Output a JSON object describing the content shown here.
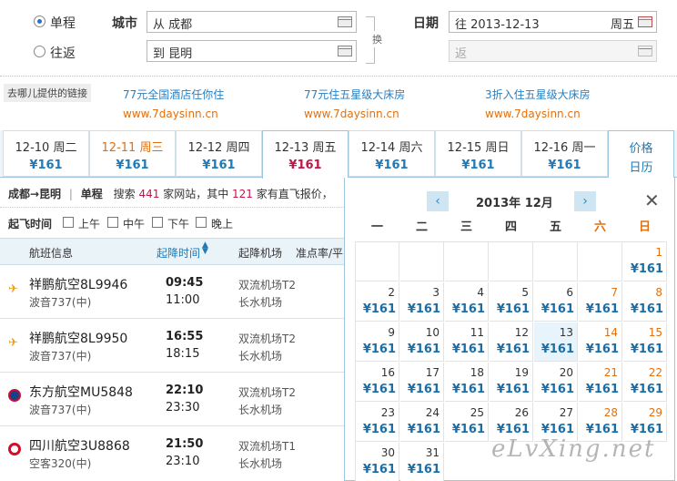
{
  "search": {
    "trip_one_way": "单程",
    "trip_round": "往返",
    "city_label": "城市",
    "from_value": "从 成都",
    "to_value": "到 昆明",
    "swap_label": "换",
    "date_label": "日期",
    "depart_value": "往 2013-12-13",
    "depart_weekday": "周五",
    "return_placeholder": "返"
  },
  "ads": {
    "provider": "去哪儿提供的链接",
    "items": [
      {
        "title": "77元全国酒店任你住",
        "url": "www.7daysinn.cn"
      },
      {
        "title": "77元住五星级大床房",
        "url": "www.7daysinn.cn"
      },
      {
        "title": "3折入住五星级大床房",
        "url": "www.7daysinn.cn"
      }
    ]
  },
  "date_tabs": [
    {
      "date": "12-10 周二",
      "price": "¥161"
    },
    {
      "date": "12-11 周三",
      "price": "¥161"
    },
    {
      "date": "12-12 周四",
      "price": "¥161"
    },
    {
      "date": "12-13 周五",
      "price": "¥161"
    },
    {
      "date": "12-14 周六",
      "price": "¥161"
    },
    {
      "date": "12-15 周日",
      "price": "¥161"
    },
    {
      "date": "12-16 周一",
      "price": "¥161"
    }
  ],
  "price_calendar_tab": {
    "line1": "价格",
    "line2": "日历"
  },
  "summary": {
    "route": "成都→昆明",
    "sep": "|",
    "trip": "单程",
    "text1": "搜索",
    "count1": "441",
    "text2": "家网站，其中",
    "count2": "121",
    "text3": "家有直飞报价，"
  },
  "filter": {
    "label": "起飞时间",
    "options": [
      "上午",
      "中午",
      "下午",
      "晚上"
    ]
  },
  "columns": {
    "flight": "航班信息",
    "time": "起降时间",
    "airport": "起降机场",
    "punctuality": "准点率/平"
  },
  "flights": [
    {
      "name": "祥鹏航空8L9946",
      "plane": "波音737(中)",
      "dep": "09:45",
      "arr": "11:00",
      "dep_airport": "双流机场T2",
      "arr_airport": "长水机场"
    },
    {
      "name": "祥鹏航空8L9950",
      "plane": "波音737(中)",
      "dep": "16:55",
      "arr": "18:15",
      "dep_airport": "双流机场T2",
      "arr_airport": "长水机场"
    },
    {
      "name": "东方航空MU5848",
      "plane": "波音737(中)",
      "dep": "22:10",
      "arr": "23:30",
      "dep_airport": "双流机场T2",
      "arr_airport": "长水机场"
    },
    {
      "name": "四川航空3U8868",
      "plane": "空客320(中)",
      "dep": "21:50",
      "arr": "23:10",
      "dep_airport": "双流机场T1",
      "arr_airport": "长水机场"
    }
  ],
  "calendar": {
    "title": "2013年 12月",
    "weekdays": [
      "一",
      "二",
      "三",
      "四",
      "五",
      "六",
      "日"
    ],
    "days": [
      {
        "d": "1",
        "p": "¥161"
      },
      {
        "d": "2",
        "p": "¥161"
      },
      {
        "d": "3",
        "p": "¥161"
      },
      {
        "d": "4",
        "p": "¥161"
      },
      {
        "d": "5",
        "p": "¥161"
      },
      {
        "d": "6",
        "p": "¥161"
      },
      {
        "d": "7",
        "p": "¥161"
      },
      {
        "d": "8",
        "p": "¥161"
      },
      {
        "d": "9",
        "p": "¥161"
      },
      {
        "d": "10",
        "p": "¥161"
      },
      {
        "d": "11",
        "p": "¥161"
      },
      {
        "d": "12",
        "p": "¥161"
      },
      {
        "d": "13",
        "p": "¥161"
      },
      {
        "d": "14",
        "p": "¥161"
      },
      {
        "d": "15",
        "p": "¥161"
      },
      {
        "d": "16",
        "p": "¥161"
      },
      {
        "d": "17",
        "p": "¥161"
      },
      {
        "d": "18",
        "p": "¥161"
      },
      {
        "d": "19",
        "p": "¥161"
      },
      {
        "d": "20",
        "p": "¥161"
      },
      {
        "d": "21",
        "p": "¥161"
      },
      {
        "d": "22",
        "p": "¥161"
      },
      {
        "d": "23",
        "p": "¥161"
      },
      {
        "d": "24",
        "p": "¥161"
      },
      {
        "d": "25",
        "p": "¥161"
      },
      {
        "d": "26",
        "p": "¥161"
      },
      {
        "d": "27",
        "p": "¥161"
      },
      {
        "d": "28",
        "p": "¥161"
      },
      {
        "d": "29",
        "p": "¥161"
      },
      {
        "d": "30",
        "p": "¥161"
      },
      {
        "d": "31",
        "p": "¥161"
      }
    ]
  },
  "watermark": "eLvXing.net",
  "colors": {
    "accent": "#1e7ab8",
    "weekend": "#e07010",
    "active_price": "#c0164a",
    "count": "#c0164a"
  }
}
